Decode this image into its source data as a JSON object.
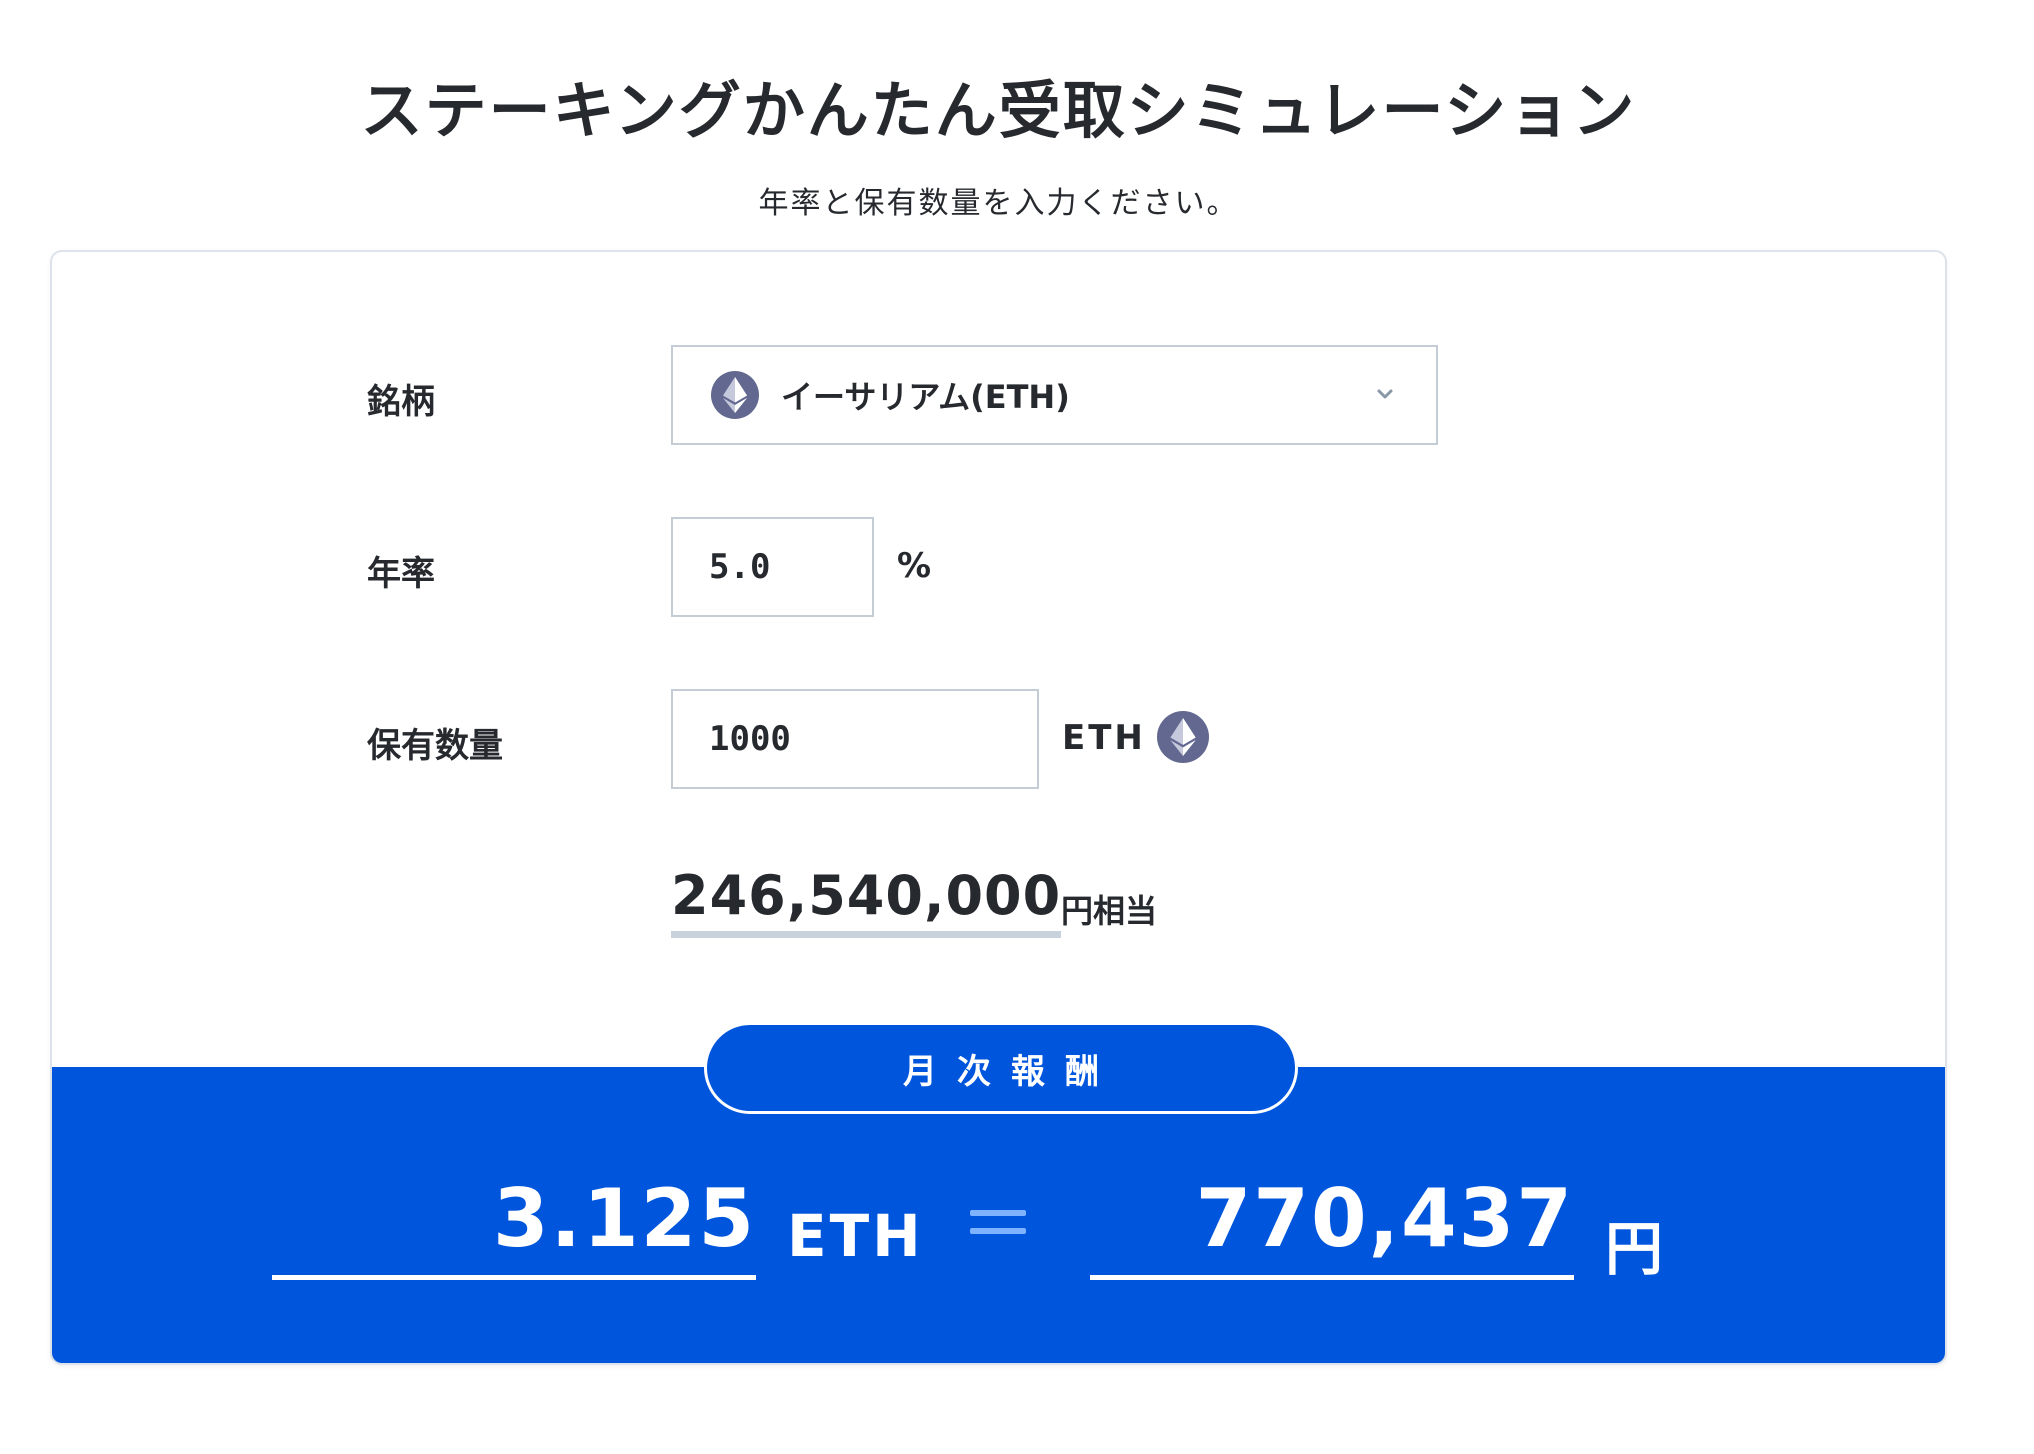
{
  "header": {
    "title": "ステーキングかんたん受取シミュレーション",
    "subtitle": "年率と保有数量を入力ください。"
  },
  "form": {
    "coin_label": "銘柄",
    "coin_selected": "イーサリアム(ETH)",
    "rate_label": "年率",
    "rate_value": "5.0",
    "rate_unit": "%",
    "quantity_label": "保有数量",
    "quantity_value": "1000",
    "quantity_unit": "ETH",
    "jpy_equivalent": "246,540,000",
    "jpy_equivalent_suffix": "円相当"
  },
  "result": {
    "period_label": "月次報酬",
    "eth_amount": "3.125",
    "eth_unit": "ETH",
    "jpy_amount": "770,437",
    "jpy_unit": "円"
  },
  "colors": {
    "accent_blue": "#0055dd",
    "eth_icon": "#62688f",
    "text_dark": "#26292e",
    "border": "#c4cdd6"
  },
  "icons": {
    "coin_icon": "ethereum-icon",
    "dropdown": "chevron-down-icon",
    "unit_icon": "ethereum-icon"
  }
}
